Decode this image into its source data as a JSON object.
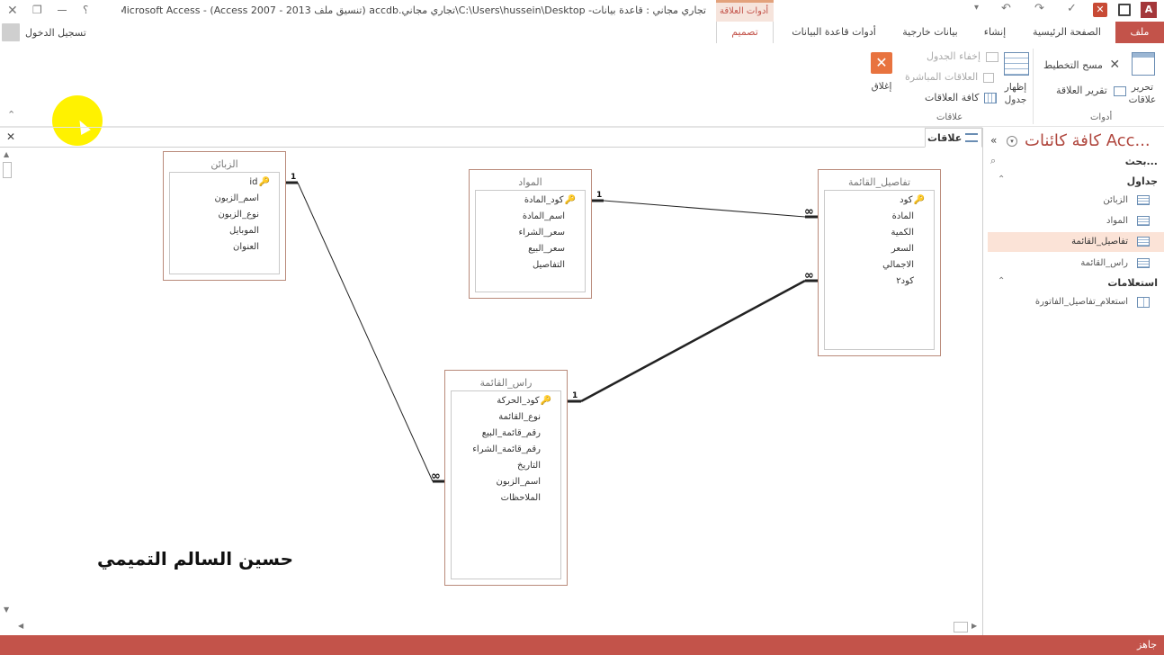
{
  "app": {
    "title": "تجاري مجاني : قاعدة بيانات- C:\\Users\\hussein\\Desktop\\تجاري مجاني.accdb (تنسيق ملف Access 2007 - 2013) - Microsoft Access",
    "contextual_tab_group": "أدوات العلاقة",
    "sign_in": "تسجيل الدخول",
    "accent_color": "#c3534a",
    "title_help": "؟"
  },
  "ribbon": {
    "tabs": [
      "ملف",
      "الصفحة الرئيسية",
      "إنشاء",
      "بيانات خارجية",
      "أدوات قاعدة البيانات",
      "تصميم"
    ],
    "tools_group": {
      "label": "أدوات",
      "edit_relationships": "تحرير علاقات",
      "clear_layout": "مسح التخطيط",
      "relationship_report": "تقرير العلاقة"
    },
    "relationships_group": {
      "label": "علاقات",
      "show_table": "إظهار جدول",
      "hide_table": "إخفاء الجدول",
      "direct_relationships": "العلاقات المباشرة",
      "all_relationships": "كافة العلاقات",
      "close": "إغلاق"
    }
  },
  "document": {
    "tab_label": "علاقات",
    "watermark": "حسين السالم التميمي"
  },
  "tables": {
    "customers": {
      "title": "الزبائن",
      "fields": [
        {
          "name": "id",
          "key": true
        },
        {
          "name": "اسم_الزبون"
        },
        {
          "name": "نوع_الزبون"
        },
        {
          "name": "الموبايل"
        },
        {
          "name": "العنوان"
        }
      ]
    },
    "materials": {
      "title": "المواد",
      "fields": [
        {
          "name": "كود_المادة",
          "key": true
        },
        {
          "name": "اسم_المادة"
        },
        {
          "name": "سعر_الشراء"
        },
        {
          "name": "سعر_البيع"
        },
        {
          "name": "التفاصيل"
        }
      ]
    },
    "invoice_details": {
      "title": "تفاصيل_القائمة",
      "fields": [
        {
          "name": "كود",
          "key": true
        },
        {
          "name": "المادة"
        },
        {
          "name": "الكمية"
        },
        {
          "name": "السعر"
        },
        {
          "name": "الاجمالي"
        },
        {
          "name": "كود٢"
        }
      ]
    },
    "invoice_head": {
      "title": "راس_القائمة",
      "fields": [
        {
          "name": "كود_الحركة",
          "key": true
        },
        {
          "name": "نوع_القائمة"
        },
        {
          "name": "رقم_قائمة_البيع"
        },
        {
          "name": "رقم_قائمة_الشراء"
        },
        {
          "name": "التاريخ"
        },
        {
          "name": "اسم_الزبون"
        },
        {
          "name": "الملاحظات"
        }
      ]
    }
  },
  "relationships": {
    "one_label": "1",
    "many_label": "∞"
  },
  "nav": {
    "title": "كافة كائنات Acc...",
    "search_placeholder": "بحث...",
    "groups": [
      {
        "label": "جداول",
        "items": [
          "الزبائن",
          "المواد",
          "تفاصيل_القائمة",
          "راس_القائمة"
        ],
        "selected": "تفاصيل_القائمة"
      },
      {
        "label": "استعلامات",
        "items": [
          "استعلام_تفاصيل_الفاتورة"
        ]
      }
    ]
  },
  "status": {
    "text": "جاهز"
  }
}
